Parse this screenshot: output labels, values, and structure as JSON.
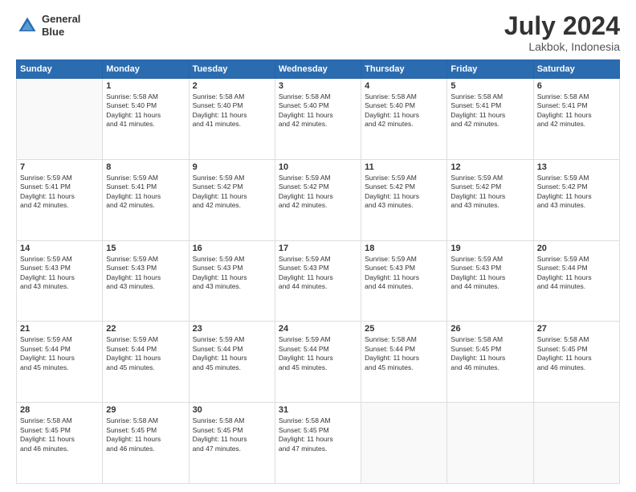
{
  "header": {
    "logo_line1": "General",
    "logo_line2": "Blue",
    "month_title": "July 2024",
    "location": "Lakbok, Indonesia"
  },
  "weekdays": [
    "Sunday",
    "Monday",
    "Tuesday",
    "Wednesday",
    "Thursday",
    "Friday",
    "Saturday"
  ],
  "weeks": [
    [
      {
        "day": "",
        "sunrise": "",
        "sunset": "",
        "daylight": ""
      },
      {
        "day": "1",
        "sunrise": "Sunrise: 5:58 AM",
        "sunset": "Sunset: 5:40 PM",
        "daylight": "Daylight: 11 hours and 41 minutes."
      },
      {
        "day": "2",
        "sunrise": "Sunrise: 5:58 AM",
        "sunset": "Sunset: 5:40 PM",
        "daylight": "Daylight: 11 hours and 41 minutes."
      },
      {
        "day": "3",
        "sunrise": "Sunrise: 5:58 AM",
        "sunset": "Sunset: 5:40 PM",
        "daylight": "Daylight: 11 hours and 42 minutes."
      },
      {
        "day": "4",
        "sunrise": "Sunrise: 5:58 AM",
        "sunset": "Sunset: 5:40 PM",
        "daylight": "Daylight: 11 hours and 42 minutes."
      },
      {
        "day": "5",
        "sunrise": "Sunrise: 5:58 AM",
        "sunset": "Sunset: 5:41 PM",
        "daylight": "Daylight: 11 hours and 42 minutes."
      },
      {
        "day": "6",
        "sunrise": "Sunrise: 5:58 AM",
        "sunset": "Sunset: 5:41 PM",
        "daylight": "Daylight: 11 hours and 42 minutes."
      }
    ],
    [
      {
        "day": "7",
        "sunrise": "Sunrise: 5:59 AM",
        "sunset": "Sunset: 5:41 PM",
        "daylight": "Daylight: 11 hours and 42 minutes."
      },
      {
        "day": "8",
        "sunrise": "Sunrise: 5:59 AM",
        "sunset": "Sunset: 5:41 PM",
        "daylight": "Daylight: 11 hours and 42 minutes."
      },
      {
        "day": "9",
        "sunrise": "Sunrise: 5:59 AM",
        "sunset": "Sunset: 5:42 PM",
        "daylight": "Daylight: 11 hours and 42 minutes."
      },
      {
        "day": "10",
        "sunrise": "Sunrise: 5:59 AM",
        "sunset": "Sunset: 5:42 PM",
        "daylight": "Daylight: 11 hours and 42 minutes."
      },
      {
        "day": "11",
        "sunrise": "Sunrise: 5:59 AM",
        "sunset": "Sunset: 5:42 PM",
        "daylight": "Daylight: 11 hours and 43 minutes."
      },
      {
        "day": "12",
        "sunrise": "Sunrise: 5:59 AM",
        "sunset": "Sunset: 5:42 PM",
        "daylight": "Daylight: 11 hours and 43 minutes."
      },
      {
        "day": "13",
        "sunrise": "Sunrise: 5:59 AM",
        "sunset": "Sunset: 5:42 PM",
        "daylight": "Daylight: 11 hours and 43 minutes."
      }
    ],
    [
      {
        "day": "14",
        "sunrise": "Sunrise: 5:59 AM",
        "sunset": "Sunset: 5:43 PM",
        "daylight": "Daylight: 11 hours and 43 minutes."
      },
      {
        "day": "15",
        "sunrise": "Sunrise: 5:59 AM",
        "sunset": "Sunset: 5:43 PM",
        "daylight": "Daylight: 11 hours and 43 minutes."
      },
      {
        "day": "16",
        "sunrise": "Sunrise: 5:59 AM",
        "sunset": "Sunset: 5:43 PM",
        "daylight": "Daylight: 11 hours and 43 minutes."
      },
      {
        "day": "17",
        "sunrise": "Sunrise: 5:59 AM",
        "sunset": "Sunset: 5:43 PM",
        "daylight": "Daylight: 11 hours and 44 minutes."
      },
      {
        "day": "18",
        "sunrise": "Sunrise: 5:59 AM",
        "sunset": "Sunset: 5:43 PM",
        "daylight": "Daylight: 11 hours and 44 minutes."
      },
      {
        "day": "19",
        "sunrise": "Sunrise: 5:59 AM",
        "sunset": "Sunset: 5:43 PM",
        "daylight": "Daylight: 11 hours and 44 minutes."
      },
      {
        "day": "20",
        "sunrise": "Sunrise: 5:59 AM",
        "sunset": "Sunset: 5:44 PM",
        "daylight": "Daylight: 11 hours and 44 minutes."
      }
    ],
    [
      {
        "day": "21",
        "sunrise": "Sunrise: 5:59 AM",
        "sunset": "Sunset: 5:44 PM",
        "daylight": "Daylight: 11 hours and 45 minutes."
      },
      {
        "day": "22",
        "sunrise": "Sunrise: 5:59 AM",
        "sunset": "Sunset: 5:44 PM",
        "daylight": "Daylight: 11 hours and 45 minutes."
      },
      {
        "day": "23",
        "sunrise": "Sunrise: 5:59 AM",
        "sunset": "Sunset: 5:44 PM",
        "daylight": "Daylight: 11 hours and 45 minutes."
      },
      {
        "day": "24",
        "sunrise": "Sunrise: 5:59 AM",
        "sunset": "Sunset: 5:44 PM",
        "daylight": "Daylight: 11 hours and 45 minutes."
      },
      {
        "day": "25",
        "sunrise": "Sunrise: 5:58 AM",
        "sunset": "Sunset: 5:44 PM",
        "daylight": "Daylight: 11 hours and 45 minutes."
      },
      {
        "day": "26",
        "sunrise": "Sunrise: 5:58 AM",
        "sunset": "Sunset: 5:45 PM",
        "daylight": "Daylight: 11 hours and 46 minutes."
      },
      {
        "day": "27",
        "sunrise": "Sunrise: 5:58 AM",
        "sunset": "Sunset: 5:45 PM",
        "daylight": "Daylight: 11 hours and 46 minutes."
      }
    ],
    [
      {
        "day": "28",
        "sunrise": "Sunrise: 5:58 AM",
        "sunset": "Sunset: 5:45 PM",
        "daylight": "Daylight: 11 hours and 46 minutes."
      },
      {
        "day": "29",
        "sunrise": "Sunrise: 5:58 AM",
        "sunset": "Sunset: 5:45 PM",
        "daylight": "Daylight: 11 hours and 46 minutes."
      },
      {
        "day": "30",
        "sunrise": "Sunrise: 5:58 AM",
        "sunset": "Sunset: 5:45 PM",
        "daylight": "Daylight: 11 hours and 47 minutes."
      },
      {
        "day": "31",
        "sunrise": "Sunrise: 5:58 AM",
        "sunset": "Sunset: 5:45 PM",
        "daylight": "Daylight: 11 hours and 47 minutes."
      },
      {
        "day": "",
        "sunrise": "",
        "sunset": "",
        "daylight": ""
      },
      {
        "day": "",
        "sunrise": "",
        "sunset": "",
        "daylight": ""
      },
      {
        "day": "",
        "sunrise": "",
        "sunset": "",
        "daylight": ""
      }
    ]
  ]
}
